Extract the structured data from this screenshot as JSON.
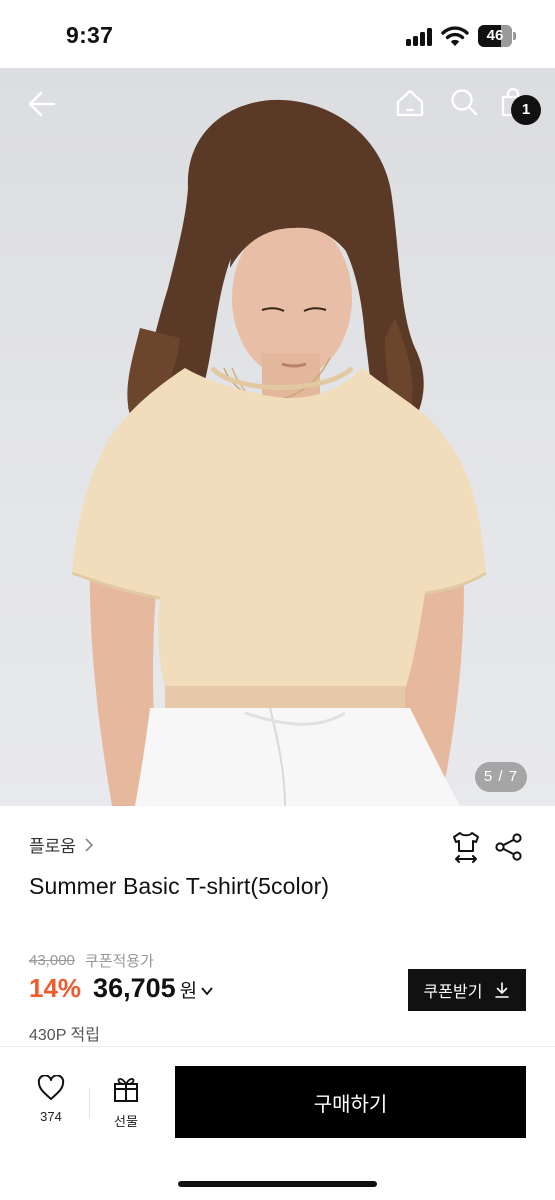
{
  "status_bar": {
    "time": "9:37",
    "battery": "46",
    "icons": [
      "signal-icon",
      "wifi-icon",
      "battery-icon"
    ]
  },
  "header": {
    "icons": [
      "back-arrow-icon",
      "home-icon",
      "search-icon",
      "shopping-bag-icon"
    ],
    "cart_count": "1"
  },
  "gallery": {
    "current": "5",
    "total": "7",
    "indicator": "5 / 7"
  },
  "product": {
    "brand": "플로움",
    "title": "Summer Basic T-shirt(5color)",
    "original_price": "43,000",
    "coupon_note": "쿠폰적용가",
    "discount": "14%",
    "price": "36,705",
    "currency": "원",
    "points": "430P 적립"
  },
  "actions": {
    "coupon_button": "쿠폰받기",
    "like_count": "374",
    "gift_label": "선물",
    "buy_button": "구매하기",
    "icons": [
      "size-guide-icon",
      "share-icon",
      "heart-icon",
      "gift-icon",
      "download-icon"
    ]
  },
  "colors": {
    "accent": "#ef5b2e",
    "primary": "#000000",
    "muted": "#999999"
  }
}
